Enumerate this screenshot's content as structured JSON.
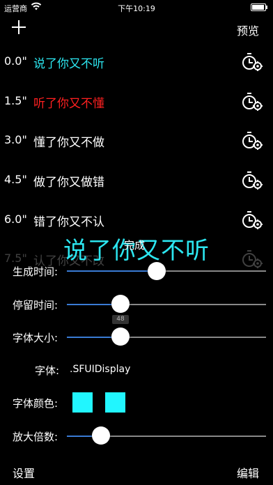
{
  "status": {
    "carrier": "运营商",
    "time": "下午10:19",
    "battery_level": 0.95
  },
  "nav": {
    "preview": "预览"
  },
  "rows": [
    {
      "time": "0.0\"",
      "text": "说了你又不听",
      "color": "#2ce6f0"
    },
    {
      "time": "1.5\"",
      "text": "听了你又不懂",
      "color": "#ff2020"
    },
    {
      "time": "3.0\"",
      "text": "懂了你又不做",
      "color": "#ffffff"
    },
    {
      "time": "4.5\"",
      "text": "做了你又做错",
      "color": "#ffffff"
    },
    {
      "time": "6.0\"",
      "text": "错了你又不认",
      "color": "#ffffff"
    },
    {
      "time": "7.5\"",
      "text": "认了你又不改",
      "color": "#ffffff"
    }
  ],
  "overlay": {
    "preview_text": "说了你又不听",
    "done_label": "完成"
  },
  "settings": {
    "gen_time_label": "生成时间:",
    "stay_time_label": "停留时间:",
    "stay_time_tooltip": "48",
    "font_size_label": "字体大小:",
    "font_label": "字体:",
    "font_value": ".SFUIDisplay",
    "font_color_label": "字体颜色:",
    "scale_label": "放大倍数:",
    "gen_time_fraction": 0.45,
    "stay_time_fraction": 0.27,
    "font_size_fraction": 0.27,
    "scale_fraction": 0.17,
    "swatch_colors": [
      "#21f6ff",
      "#21f6ff"
    ]
  },
  "footer": {
    "settings": "设置",
    "edit": "编辑"
  }
}
